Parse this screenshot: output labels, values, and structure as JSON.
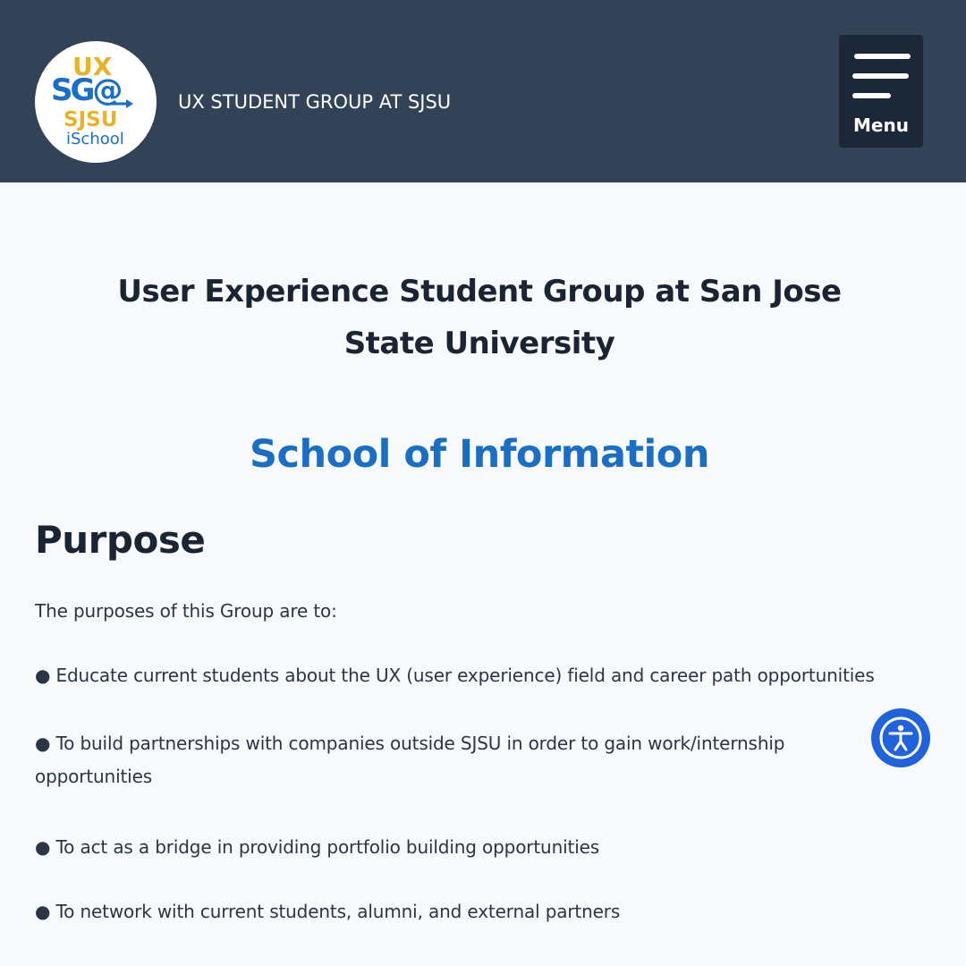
{
  "header": {
    "logo": {
      "label": "UX SG@ SJSU iSchool",
      "lines": [
        "UX",
        "SG@",
        "SJSU",
        "iSchool"
      ]
    },
    "site_title": "UX STUDENT GROUP AT SJSU",
    "menu_label": "Menu"
  },
  "main": {
    "heading": "User Experience Student Group at San Jose State University",
    "subheading": "School of Information",
    "section_title": "Purpose",
    "intro": "The purposes of this Group are to:",
    "items": [
      "● Educate current students about the UX (user experience) field and career path opportunities",
      "● To build partnerships with companies outside SJSU in order to gain work/internship opportunities",
      "● To act as a bridge in providing portfolio building opportunities",
      "● To network with current students, alumni, and external partners"
    ]
  },
  "accessibility_button": {
    "icon": "accessibility-icon"
  },
  "colors": {
    "header_bg": "#334357",
    "menu_bg": "#1c2838",
    "accent_blue": "#1a6fc4",
    "accessibility_blue": "#1f62dc",
    "logo_gold": "#e8b22a",
    "logo_blue": "#1a6fc4"
  }
}
